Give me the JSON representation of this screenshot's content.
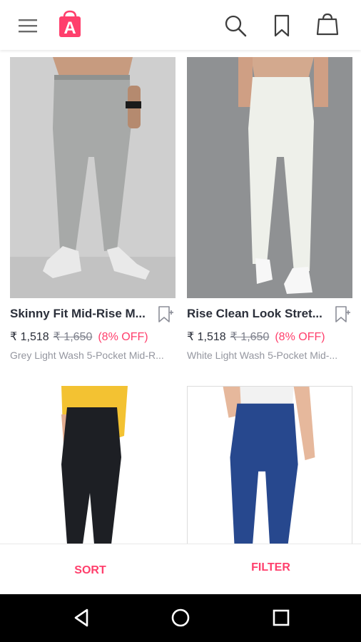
{
  "brand": {
    "logo_letter": "A",
    "accent_color": "#ff3f6c",
    "logo_color": "#ff3f6c"
  },
  "header": {
    "icons": [
      "menu-icon",
      "myntra-logo-icon",
      "search-icon",
      "bookmark-icon",
      "bag-icon"
    ]
  },
  "products": [
    {
      "name": "Skinny Fit Mid-Rise M...",
      "price": "₹ 1,518",
      "mrp": "₹ 1,650",
      "discount": "(8% OFF)",
      "description": "Grey Light Wash 5-Pocket Mid-R...",
      "jeans_color": "#a7a9a8",
      "bg_color": "#cfcfcf"
    },
    {
      "name": "Rise Clean Look Stret...",
      "price": "₹ 1,518",
      "mrp": "₹ 1,650",
      "discount": "(8% OFF)",
      "description": "White Light Wash 5-Pocket Mid-...",
      "jeans_color": "#eef0ea",
      "bg_color": "#8f9193"
    },
    {
      "jeans_color": "#1d1f24",
      "bg_color": "#ffffff",
      "top_color": "#f3c232"
    },
    {
      "jeans_color": "#27488e",
      "bg_color": "#ffffff",
      "top_color": "#f2f2f2"
    }
  ],
  "actions": {
    "sort_label": "SORT",
    "filter_label": "FILTER"
  },
  "system_nav": {
    "icons": [
      "back-icon",
      "home-icon",
      "recents-icon"
    ]
  }
}
